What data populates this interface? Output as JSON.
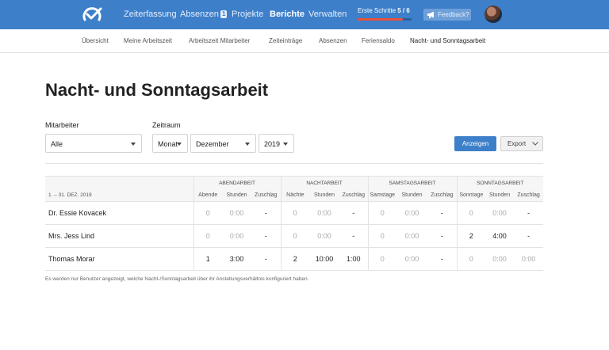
{
  "nav": {
    "items": [
      {
        "label": "Zeiterfassung",
        "active": false
      },
      {
        "label": "Absenzen",
        "badge": "1",
        "active": false
      },
      {
        "label": "Projekte",
        "active": false
      },
      {
        "label": "Berichte",
        "active": true
      },
      {
        "label": "Verwalten",
        "active": false
      }
    ],
    "progress": {
      "label": "Erste Schritte",
      "value": "5 / 6",
      "fraction": 0.8333
    },
    "feedback_label": "Feedback?",
    "icons": {
      "logo": "check-circle-logo",
      "feedback": "megaphone-icon",
      "avatar": "user-avatar"
    }
  },
  "subnav": {
    "items": [
      {
        "label": "Übersicht",
        "active": false
      },
      {
        "label": "Meine Arbeitszeit",
        "active": false
      },
      {
        "label": "Arbeitszeit Mitarbeiter",
        "active": false
      },
      {
        "label": "Zeiteinträge",
        "active": false
      },
      {
        "label": "Absenzen",
        "active": false
      },
      {
        "label": "Feriensaldo",
        "active": false
      },
      {
        "label": "Nacht- und Sonntagsarbeit",
        "active": true
      }
    ]
  },
  "page": {
    "title": "Nacht- und Sonntagsarbeit"
  },
  "filters": {
    "employee_label": "Mitarbeiter",
    "employee_value": "Alle",
    "period_label": "Zeitraum",
    "period_unit": "Monat",
    "period_month": "Dezember",
    "period_year": "2019",
    "show_button": "Anzeigen",
    "export_button": "Export"
  },
  "table": {
    "range": "1. – 31. DEZ. 2019",
    "groups": [
      "ABENDARBEIT",
      "NACHTARBEIT",
      "SAMSTAGSARBEIT",
      "SONNTAGSARBEIT"
    ],
    "subheaders": [
      [
        "Abende",
        "Stunden",
        "Zuschlag"
      ],
      [
        "Nächte",
        "Stunden",
        "Zuschlag"
      ],
      [
        "Samstage",
        "Stunden",
        "Zuschlag"
      ],
      [
        "Sonntage",
        "Stunden",
        "Zuschlag"
      ]
    ],
    "rows": [
      {
        "name": "Dr. Essie Kovacek",
        "cells": [
          "0",
          "0:00",
          "-",
          "0",
          "0:00",
          "-",
          "0",
          "0:00",
          "-",
          "0",
          "0:00",
          "-"
        ]
      },
      {
        "name": "Mrs. Jess Lind",
        "cells": [
          "0",
          "0:00",
          "-",
          "0",
          "0:00",
          "-",
          "0",
          "0:00",
          "-",
          "2",
          "4:00",
          "-"
        ]
      },
      {
        "name": "Thomas Morar",
        "cells": [
          "1",
          "3:00",
          "-",
          "2",
          "10:00",
          "1:00",
          "0",
          "0:00",
          "-",
          "0",
          "0:00",
          "0:00"
        ]
      }
    ]
  },
  "footnote": "Es werden nur Benutzer angezeigt, welche Nacht-/Sonntagsarbeit über ihr Anstellungsverhältnis konfiguriert haben.",
  "colors": {
    "brand": "#3d7fc9",
    "progress": "#e8533a"
  }
}
